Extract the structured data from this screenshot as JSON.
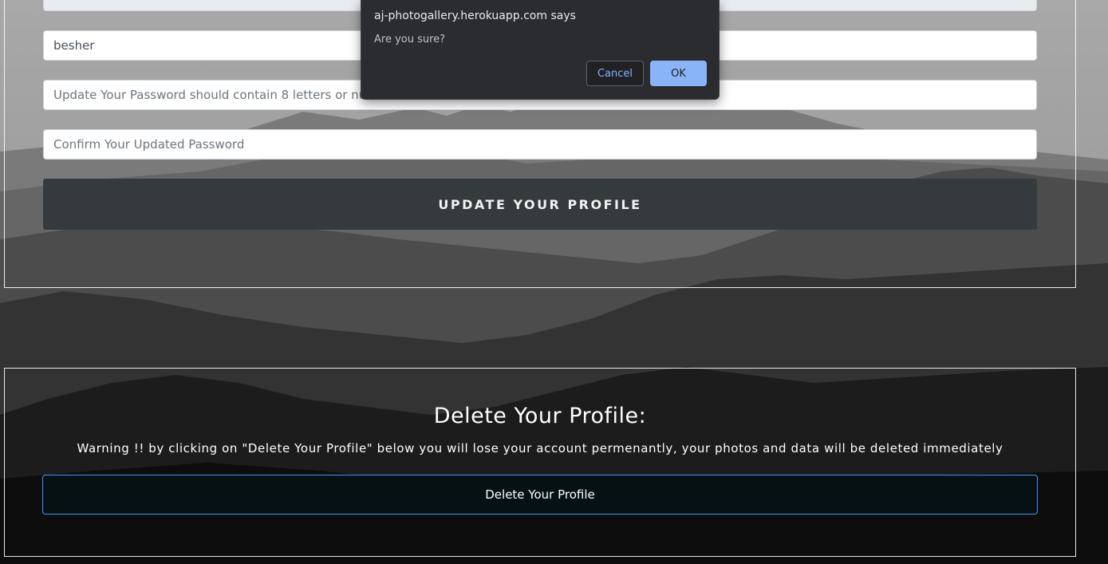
{
  "colors": {
    "accent": "#8ab4f8",
    "update_button_bg": "#353b3c",
    "delete_button_bg": "#061114",
    "delete_button_border": "#4a90ff",
    "dialog_bg": "#2b2c2f"
  },
  "profile_form": {
    "top_field_value": "",
    "username_value": "besher",
    "password_placeholder": "Update Your Password should contain 8 letters or numbers",
    "confirm_placeholder": "Confirm Your Updated Password",
    "update_button_label": "UPDATE YOUR PROFILE"
  },
  "delete_section": {
    "title": "Delete Your Profile:",
    "warning": "Warning !! by clicking on \"Delete Your Profile\" below you will lose your account permenantly, your photos and data will be deleted immediately",
    "button_label": "Delete Your Profile"
  },
  "confirm_dialog": {
    "origin": "aj-photogallery.herokuapp.com says",
    "message": "Are you sure?",
    "cancel_label": "Cancel",
    "ok_label": "OK"
  }
}
